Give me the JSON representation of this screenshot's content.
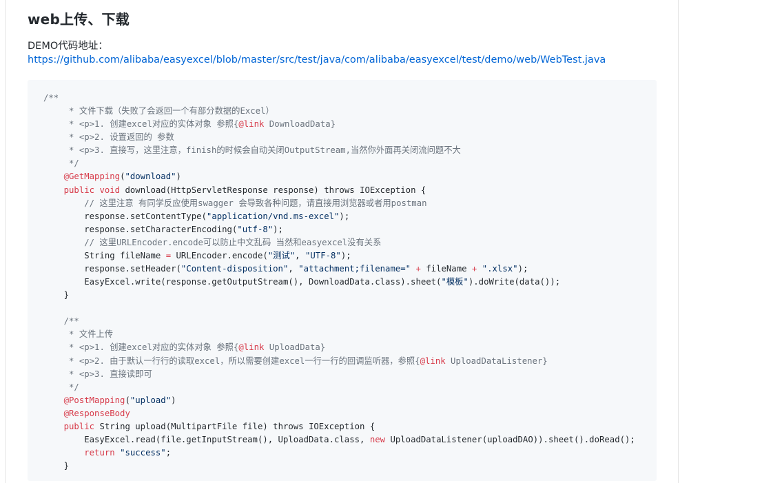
{
  "article": {
    "heading": "web上传、下载",
    "demo_label": "DEMO代码地址：",
    "demo_link": "https://github.com/alibaba/easyexcel/blob/master/src/test/java/com/alibaba/easyexcel/test/demo/web/WebTest.java"
  },
  "colors": {
    "link": "#0366d6",
    "code_background": "#f6f8fa",
    "keyword": "#d73a49",
    "comment": "#6a737d",
    "string": "#032f62",
    "text": "#24292e"
  },
  "code_lines": [
    [
      {
        "t": "/**",
        "c": "com"
      }
    ],
    [
      {
        "t": "     * 文件下载（失败了会返回一个有部分数据的Excel）",
        "c": "com"
      }
    ],
    [
      {
        "t": "     * ",
        "c": "com"
      },
      {
        "t": "<p>",
        "c": "com"
      },
      {
        "t": "1. 创建excel对应的实体对象 参照{",
        "c": "com"
      },
      {
        "t": "@link",
        "c": "tag"
      },
      {
        "t": " DownloadData}",
        "c": "com"
      }
    ],
    [
      {
        "t": "     * ",
        "c": "com"
      },
      {
        "t": "<p>",
        "c": "com"
      },
      {
        "t": "2. 设置返回的 参数",
        "c": "com"
      }
    ],
    [
      {
        "t": "     * ",
        "c": "com"
      },
      {
        "t": "<p>",
        "c": "com"
      },
      {
        "t": "3. 直接写，这里注意，finish的时候会自动关闭OutputStream,当然你外面再关闭流问题不大",
        "c": "com"
      }
    ],
    [
      {
        "t": "     */",
        "c": "com"
      }
    ],
    [
      {
        "t": "    ",
        "c": "txt"
      },
      {
        "t": "@GetMapping",
        "c": "ann"
      },
      {
        "t": "(",
        "c": "txt"
      },
      {
        "t": "\"download\"",
        "c": "str"
      },
      {
        "t": ")",
        "c": "txt"
      }
    ],
    [
      {
        "t": "    ",
        "c": "txt"
      },
      {
        "t": "public",
        "c": "kw"
      },
      {
        "t": " ",
        "c": "txt"
      },
      {
        "t": "void",
        "c": "kw"
      },
      {
        "t": " download(HttpServletResponse response) throws IOException {",
        "c": "txt"
      }
    ],
    [
      {
        "t": "        // 这里注意 有同学反应使用swagger 会导致各种问题，请直接用浏览器或者用postman",
        "c": "com"
      }
    ],
    [
      {
        "t": "        response.setContentType(",
        "c": "txt"
      },
      {
        "t": "\"application/vnd.ms-excel\"",
        "c": "str"
      },
      {
        "t": ");",
        "c": "txt"
      }
    ],
    [
      {
        "t": "        response.setCharacterEncoding(",
        "c": "txt"
      },
      {
        "t": "\"utf-8\"",
        "c": "str"
      },
      {
        "t": ");",
        "c": "txt"
      }
    ],
    [
      {
        "t": "        // 这里URLEncoder.encode可以防止中文乱码 当然和easyexcel没有关系",
        "c": "com"
      }
    ],
    [
      {
        "t": "        String fileName ",
        "c": "txt"
      },
      {
        "t": "=",
        "c": "kw"
      },
      {
        "t": " URLEncoder.encode(",
        "c": "txt"
      },
      {
        "t": "\"测试\"",
        "c": "str"
      },
      {
        "t": ", ",
        "c": "txt"
      },
      {
        "t": "\"UTF-8\"",
        "c": "str"
      },
      {
        "t": ");",
        "c": "txt"
      }
    ],
    [
      {
        "t": "        response.setHeader(",
        "c": "txt"
      },
      {
        "t": "\"Content-disposition\"",
        "c": "str"
      },
      {
        "t": ", ",
        "c": "txt"
      },
      {
        "t": "\"attachment;filename=\"",
        "c": "str"
      },
      {
        "t": " ",
        "c": "txt"
      },
      {
        "t": "+",
        "c": "kw"
      },
      {
        "t": " fileName ",
        "c": "txt"
      },
      {
        "t": "+",
        "c": "kw"
      },
      {
        "t": " ",
        "c": "txt"
      },
      {
        "t": "\".xlsx\"",
        "c": "str"
      },
      {
        "t": ");",
        "c": "txt"
      }
    ],
    [
      {
        "t": "        EasyExcel.write(response.getOutputStream(), DownloadData.class).sheet(",
        "c": "txt"
      },
      {
        "t": "\"模板\"",
        "c": "str"
      },
      {
        "t": ").doWrite(data());",
        "c": "txt"
      }
    ],
    [
      {
        "t": "    }",
        "c": "txt"
      }
    ],
    [
      {
        "t": "",
        "c": "txt"
      }
    ],
    [
      {
        "t": "    /**",
        "c": "com"
      }
    ],
    [
      {
        "t": "     * 文件上传",
        "c": "com"
      }
    ],
    [
      {
        "t": "     * ",
        "c": "com"
      },
      {
        "t": "<p>",
        "c": "com"
      },
      {
        "t": "1. 创建excel对应的实体对象 参照{",
        "c": "com"
      },
      {
        "t": "@link",
        "c": "tag"
      },
      {
        "t": " UploadData}",
        "c": "com"
      }
    ],
    [
      {
        "t": "     * ",
        "c": "com"
      },
      {
        "t": "<p>",
        "c": "com"
      },
      {
        "t": "2. 由于默认一行行的读取excel，所以需要创建excel一行一行的回调监听器，参照{",
        "c": "com"
      },
      {
        "t": "@link",
        "c": "tag"
      },
      {
        "t": " UploadDataListener}",
        "c": "com"
      }
    ],
    [
      {
        "t": "     * ",
        "c": "com"
      },
      {
        "t": "<p>",
        "c": "com"
      },
      {
        "t": "3. 直接读即可",
        "c": "com"
      }
    ],
    [
      {
        "t": "     */",
        "c": "com"
      }
    ],
    [
      {
        "t": "    ",
        "c": "txt"
      },
      {
        "t": "@PostMapping",
        "c": "ann"
      },
      {
        "t": "(",
        "c": "txt"
      },
      {
        "t": "\"upload\"",
        "c": "str"
      },
      {
        "t": ")",
        "c": "txt"
      }
    ],
    [
      {
        "t": "    ",
        "c": "txt"
      },
      {
        "t": "@ResponseBody",
        "c": "ann"
      }
    ],
    [
      {
        "t": "    ",
        "c": "txt"
      },
      {
        "t": "public",
        "c": "kw"
      },
      {
        "t": " String upload(MultipartFile file) throws IOException {",
        "c": "txt"
      }
    ],
    [
      {
        "t": "        EasyExcel.read(file.getInputStream(), UploadData.class, ",
        "c": "txt"
      },
      {
        "t": "new",
        "c": "kw"
      },
      {
        "t": " UploadDataListener(uploadDAO)).sheet().doRead();",
        "c": "txt"
      }
    ],
    [
      {
        "t": "        ",
        "c": "txt"
      },
      {
        "t": "return",
        "c": "kw"
      },
      {
        "t": " ",
        "c": "txt"
      },
      {
        "t": "\"success\"",
        "c": "str"
      },
      {
        "t": ";",
        "c": "txt"
      }
    ],
    [
      {
        "t": "    }",
        "c": "txt"
      }
    ]
  ]
}
